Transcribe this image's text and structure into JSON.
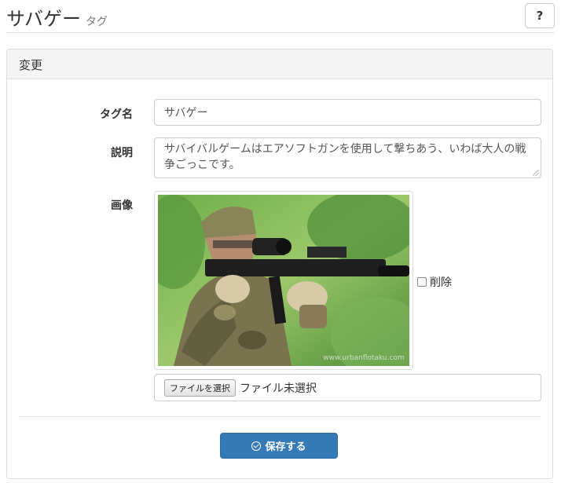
{
  "header": {
    "title": "サバゲー",
    "subtitle": "タグ",
    "help_label": "?"
  },
  "panel": {
    "heading": "変更"
  },
  "form": {
    "tag_name_label": "タグ名",
    "tag_name_value": "サバゲー",
    "description_label": "説明",
    "description_value": "サバイバルゲームはエアソフトガンを使用して撃ちあう、いわば大人の戦争ごっこです。",
    "image_label": "画像",
    "image_watermark": "www.urbanflotaku.com",
    "delete_label": "削除",
    "delete_checked": false,
    "file_button_label": "ファイルを選択",
    "file_status": "ファイル未選択",
    "save_label": "保存する"
  },
  "colors": {
    "primary": "#337ab7",
    "panel_heading_bg": "#f5f5f5"
  },
  "icons": {
    "save": "check-circle-icon"
  }
}
